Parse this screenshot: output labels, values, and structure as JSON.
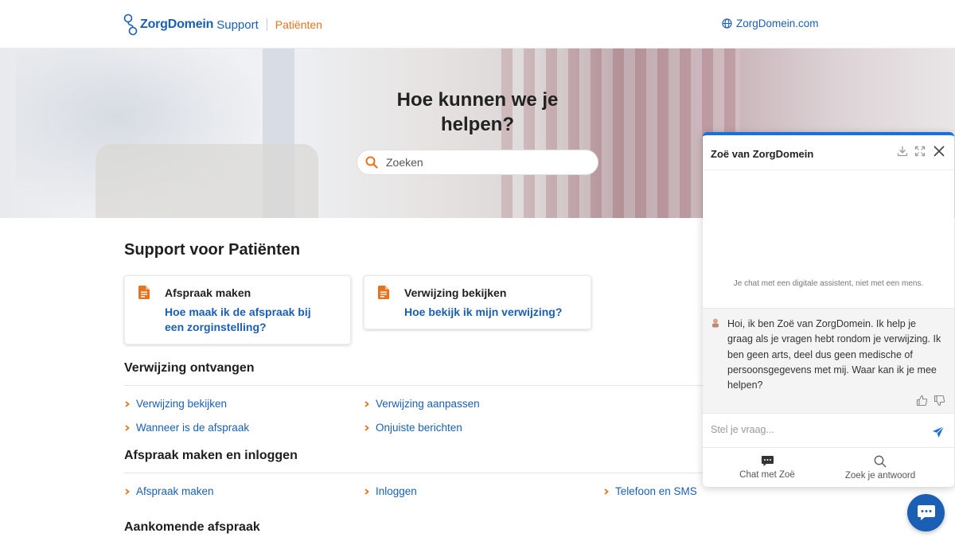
{
  "header": {
    "brand": "ZorgDomein",
    "support": "Support",
    "audience": "Patiënten",
    "site_link": "ZorgDomein.com"
  },
  "hero": {
    "title": "Hoe kunnen we je helpen?",
    "search_placeholder": "Zoeken"
  },
  "main": {
    "title": "Support voor Patiënten",
    "cards": [
      {
        "title": "Afspraak maken",
        "link": "Hoe maak ik de afspraak bij een zorginstelling?"
      },
      {
        "title": "Verwijzing bekijken",
        "link": "Hoe bekijk ik mijn verwijzing?"
      }
    ],
    "sections": [
      {
        "title": "Verwijzing ontvangen",
        "links": [
          "Verwijzing bekijken",
          "Verwijzing aanpassen",
          "Wanneer is de afspraak",
          "Onjuiste berichten"
        ]
      },
      {
        "title": "Afspraak maken en inloggen",
        "links": [
          "Afspraak maken",
          "Inloggen",
          "Telefoon en SMS"
        ]
      },
      {
        "title": "Aankomende afspraak",
        "links": []
      }
    ]
  },
  "chat": {
    "title": "Zoë van ZorgDomein",
    "disclaimer": "Je chat met een digitale assistent, niet met een mens.",
    "message": "Hoi, ik ben Zoë van ZorgDomein. Ik help je graag als je vragen hebt rondom je verwijzing. Ik ben geen arts, deel dus geen medische of persoonsgegevens met mij. Waar kan ik je mee helpen?",
    "input_placeholder": "Stel je vraag...",
    "tabs": [
      "Chat met Zoë",
      "Zoek je antwoord"
    ],
    "accent_color": "#1a6fd8"
  },
  "colors": {
    "brand_blue": "#1a5fb4",
    "accent_orange": "#e8731e"
  }
}
